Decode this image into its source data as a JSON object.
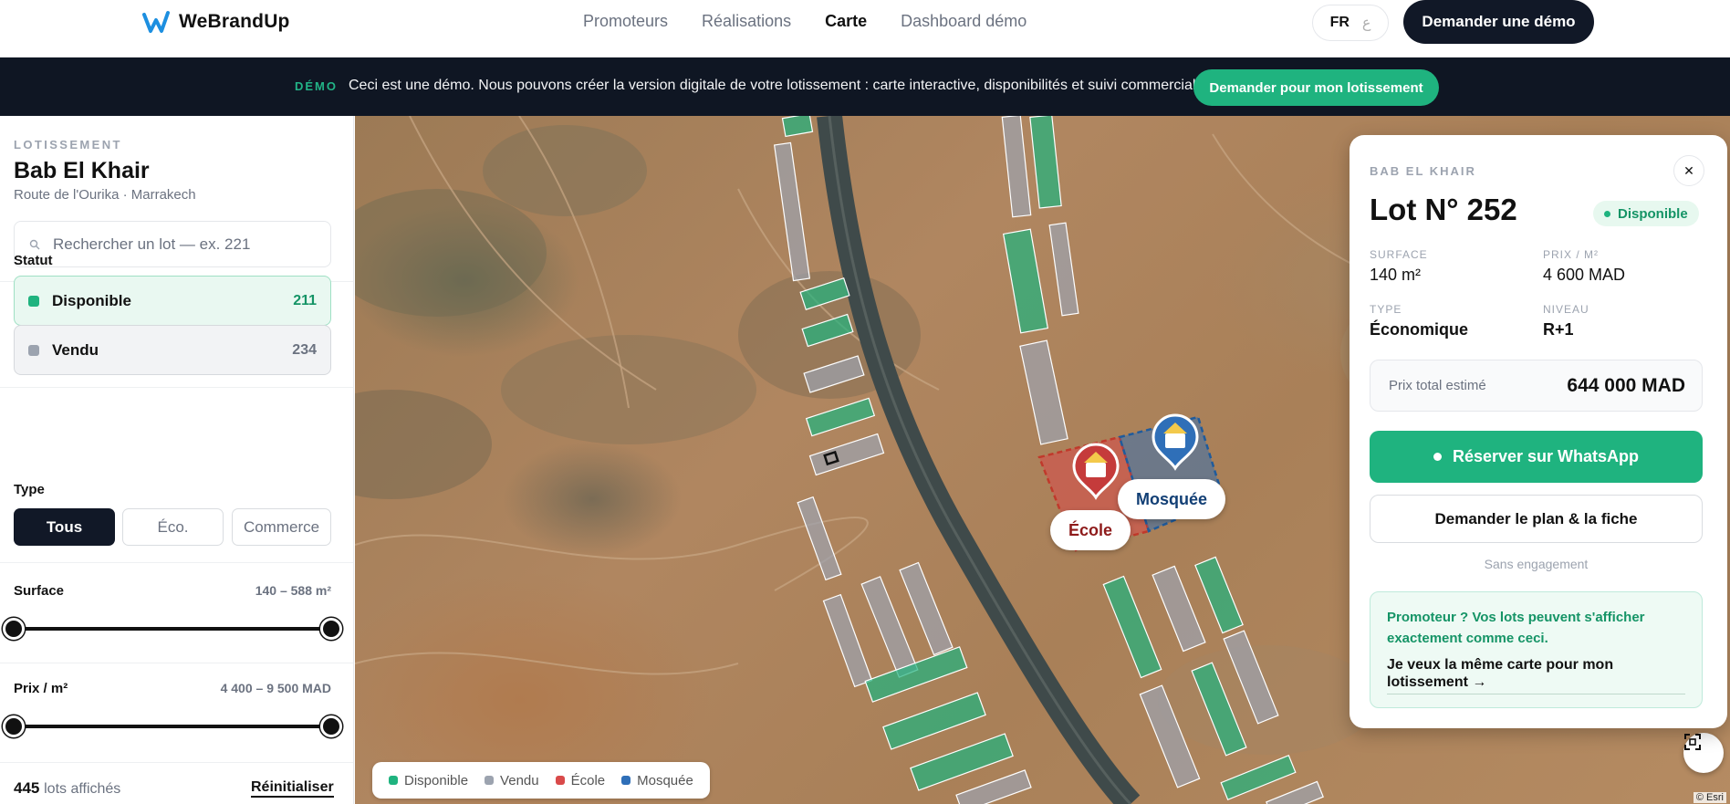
{
  "brand": {
    "name": "WeBrandUp"
  },
  "nav": {
    "links": [
      "Promoteurs",
      "Réalisations",
      "Carte",
      "Dashboard démo"
    ],
    "active": "Carte",
    "lang_active": "FR",
    "lang_alt": "ع",
    "demo_button": "Demander une démo"
  },
  "banner": {
    "tag": "DÉMO",
    "text": "Ceci est une démo. Nous pouvons créer la version digitale de votre lotissement : carte interactive, disponibilités et suivi commercial.",
    "button": "Demander pour mon lotissement"
  },
  "sidebar": {
    "kicker": "LOTISSEMENT",
    "title": "Bab El Khair",
    "subtitle": "Route de l'Ourika · Marrakech",
    "search_placeholder": "Rechercher un lot — ex. 221",
    "status_label": "Statut",
    "statuses": [
      {
        "label": "Disponible",
        "count": "211"
      },
      {
        "label": "Vendu",
        "count": "234"
      }
    ],
    "type_label": "Type",
    "types": [
      "Tous",
      "Éco.",
      "Commerce"
    ],
    "surface": {
      "label": "Surface",
      "range": "140 – 588 m²"
    },
    "prix": {
      "label": "Prix / m²",
      "range": "4 400 – 9 500 MAD"
    },
    "count_value": "445",
    "count_suffix": "lots affichés",
    "reset": "Réinitialiser"
  },
  "map": {
    "pins": {
      "ecole": "École",
      "mosquee": "Mosquée"
    },
    "legend": [
      "Disponible",
      "Vendu",
      "École",
      "Mosquée"
    ],
    "attribution": "© Esri",
    "colors": {
      "disponible": "#1fb37f",
      "vendu": "#9ca3af",
      "ecole": "#d94a4a",
      "mosquee": "#2f6fb8"
    }
  },
  "lot": {
    "kicker": "BAB EL KHAIR",
    "title": "Lot N° 252",
    "status": "Disponible",
    "surface_label": "SURFACE",
    "surface": "140 m²",
    "prix_label": "PRIX / M²",
    "prix": "4 600 MAD",
    "type_label": "TYPE",
    "type": "Économique",
    "niveau_label": "NIVEAU",
    "niveau": "R+1",
    "total_label": "Prix total estimé",
    "total": "644 000 MAD",
    "whatsapp": "Réserver sur WhatsApp",
    "plan": "Demander le plan & la fiche",
    "note": "Sans engagement",
    "promo_title": "Promoteur ? Vos lots peuvent s'afficher exactement comme ceci.",
    "promo_link": "Je veux la même carte pour mon lotissement →"
  }
}
